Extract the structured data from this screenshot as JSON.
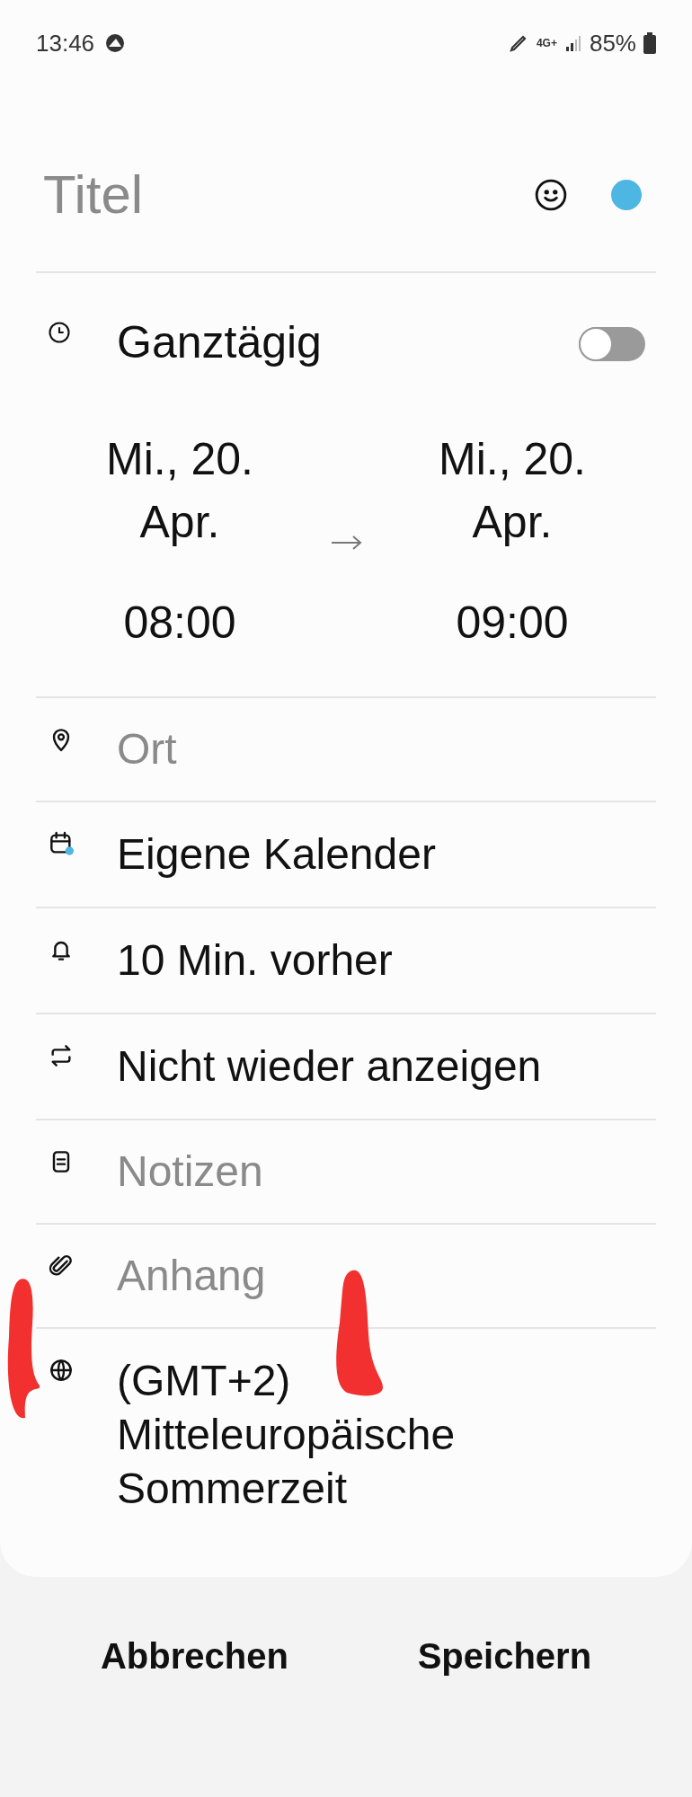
{
  "status_bar": {
    "time": "13:46",
    "battery": "85%",
    "network": "4G+"
  },
  "title": {
    "placeholder": "Titel",
    "color": "#4db6e2"
  },
  "all_day": {
    "label": "Ganztägig",
    "on": false
  },
  "start": {
    "date": "Mi., 20. Apr.",
    "time": "08:00"
  },
  "end": {
    "date": "Mi., 20. Apr.",
    "time": "09:00"
  },
  "rows": [
    {
      "kind": "field",
      "placeholder": "Ort"
    },
    {
      "kind": "value",
      "text": "Eigene Kalender"
    },
    {
      "kind": "value",
      "text": "10 Min. vorher"
    },
    {
      "kind": "value",
      "text": "Nicht wieder anzeigen"
    },
    {
      "kind": "field",
      "placeholder": "Notizen"
    },
    {
      "kind": "field",
      "placeholder": "Anhang"
    },
    {
      "kind": "value",
      "text": "(GMT+2) Mitteleuropäische Sommerzeit"
    }
  ],
  "buttons": [
    "Abbrechen",
    "Speichern"
  ]
}
